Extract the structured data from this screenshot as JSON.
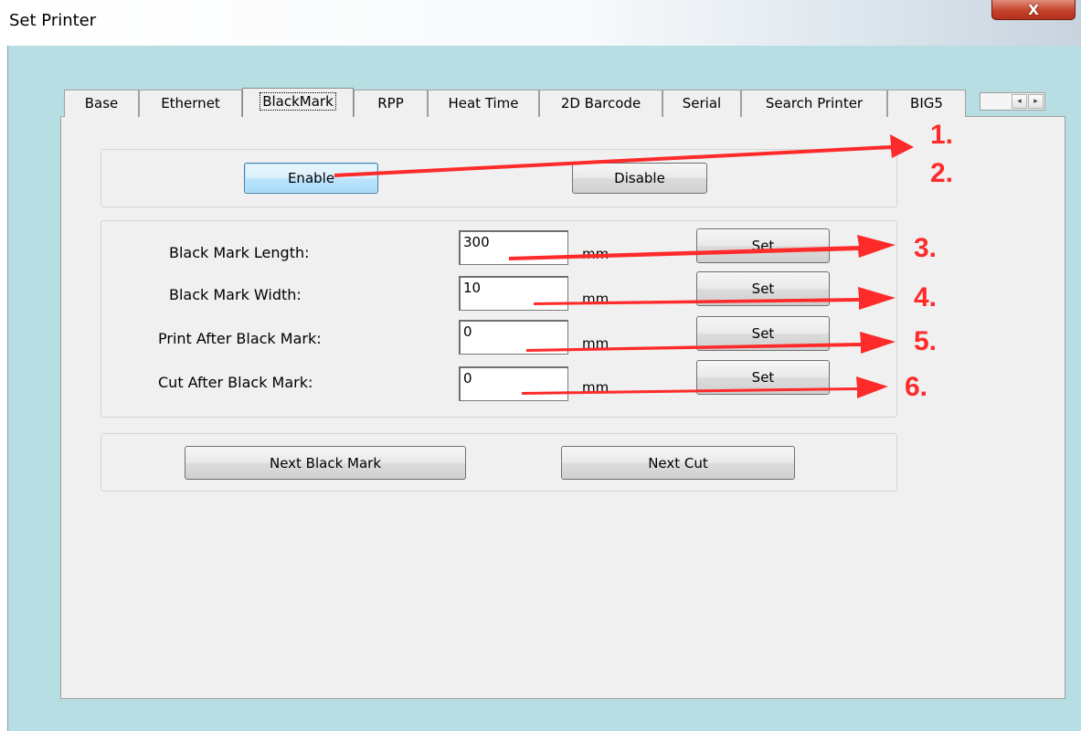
{
  "window": {
    "title": "Set Printer",
    "close_label": "X"
  },
  "tabs": [
    {
      "label": "Base"
    },
    {
      "label": "Ethernet"
    },
    {
      "label": "BlackMark",
      "active": true
    },
    {
      "label": "RPP"
    },
    {
      "label": "Heat Time"
    },
    {
      "label": "2D Barcode"
    },
    {
      "label": "Serial"
    },
    {
      "label": "Search Printer"
    },
    {
      "label": "BIG5"
    }
  ],
  "tab_scroll": {
    "left_icon": "◂",
    "right_icon": "▸"
  },
  "enable_group": {
    "enable_label": "Enable",
    "disable_label": "Disable"
  },
  "settings": [
    {
      "label": "Black Mark Length:",
      "value": "300",
      "unit": "mm",
      "button": "Set"
    },
    {
      "label": "Black Mark Width:",
      "value": "10",
      "unit": "mm",
      "button": "Set"
    },
    {
      "label": "Print After Black Mark:",
      "value": "0",
      "unit": "mm",
      "button": "Set"
    },
    {
      "label": "Cut After Black Mark:",
      "value": "0",
      "unit": "mm",
      "button": "Set"
    }
  ],
  "actions": {
    "next_black_mark_label": "Next Black Mark",
    "next_cut_label": "Next Cut"
  },
  "annotations": {
    "color": "#ff2a2a",
    "markers": [
      "1.",
      "2.",
      "3.",
      "4.",
      "5.",
      "6."
    ]
  }
}
